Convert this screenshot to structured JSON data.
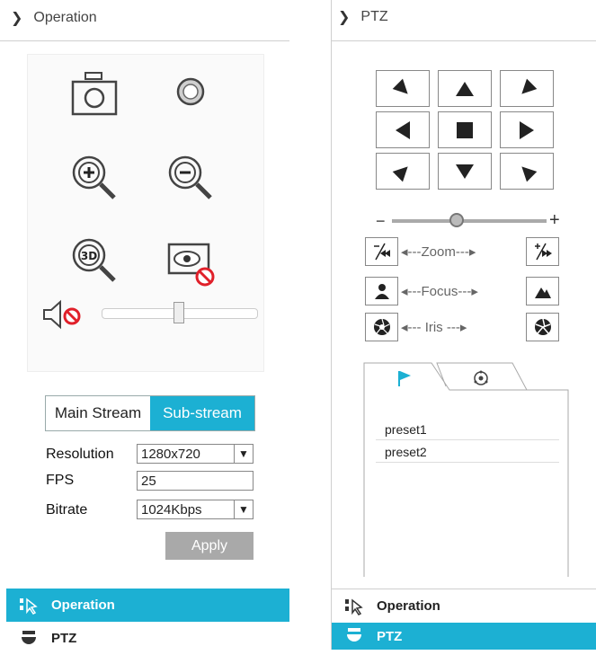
{
  "left_panel": {
    "header": {
      "title": "Operation"
    },
    "icons": [
      "snapshot-icon",
      "record-icon",
      "zoom-in-icon",
      "zoom-out-icon",
      "3d-zoom-icon",
      "privacy-mask-off-icon",
      "audio-muted-icon"
    ],
    "volume": {
      "level": 0.5
    },
    "stream": {
      "main_label": "Main Stream",
      "sub_label": "Sub-stream",
      "active": "Sub-stream"
    },
    "settings": {
      "resolution_label": "Resolution",
      "resolution_value": "1280x720",
      "fps_label": "FPS",
      "fps_value": "25",
      "bitrate_label": "Bitrate",
      "bitrate_value": "1024Kbps"
    },
    "apply_label": "Apply",
    "nav": {
      "operation_label": "Operation",
      "ptz_label": "PTZ",
      "active": "Operation"
    }
  },
  "right_panel": {
    "header": {
      "title": "PTZ"
    },
    "speed": {
      "minus": "−",
      "plus": "+",
      "level": 0.4
    },
    "zoom_label": "Zoom",
    "focus_label": "Focus",
    "iris_label": "Iris",
    "presets": [
      "preset1",
      "preset2"
    ],
    "nav": {
      "operation_label": "Operation",
      "ptz_label": "PTZ",
      "active": "PTZ"
    }
  },
  "colors": {
    "accent": "#1cb0d3",
    "muted_red": "#e0202a",
    "apply_gray": "#a9a9a9"
  }
}
